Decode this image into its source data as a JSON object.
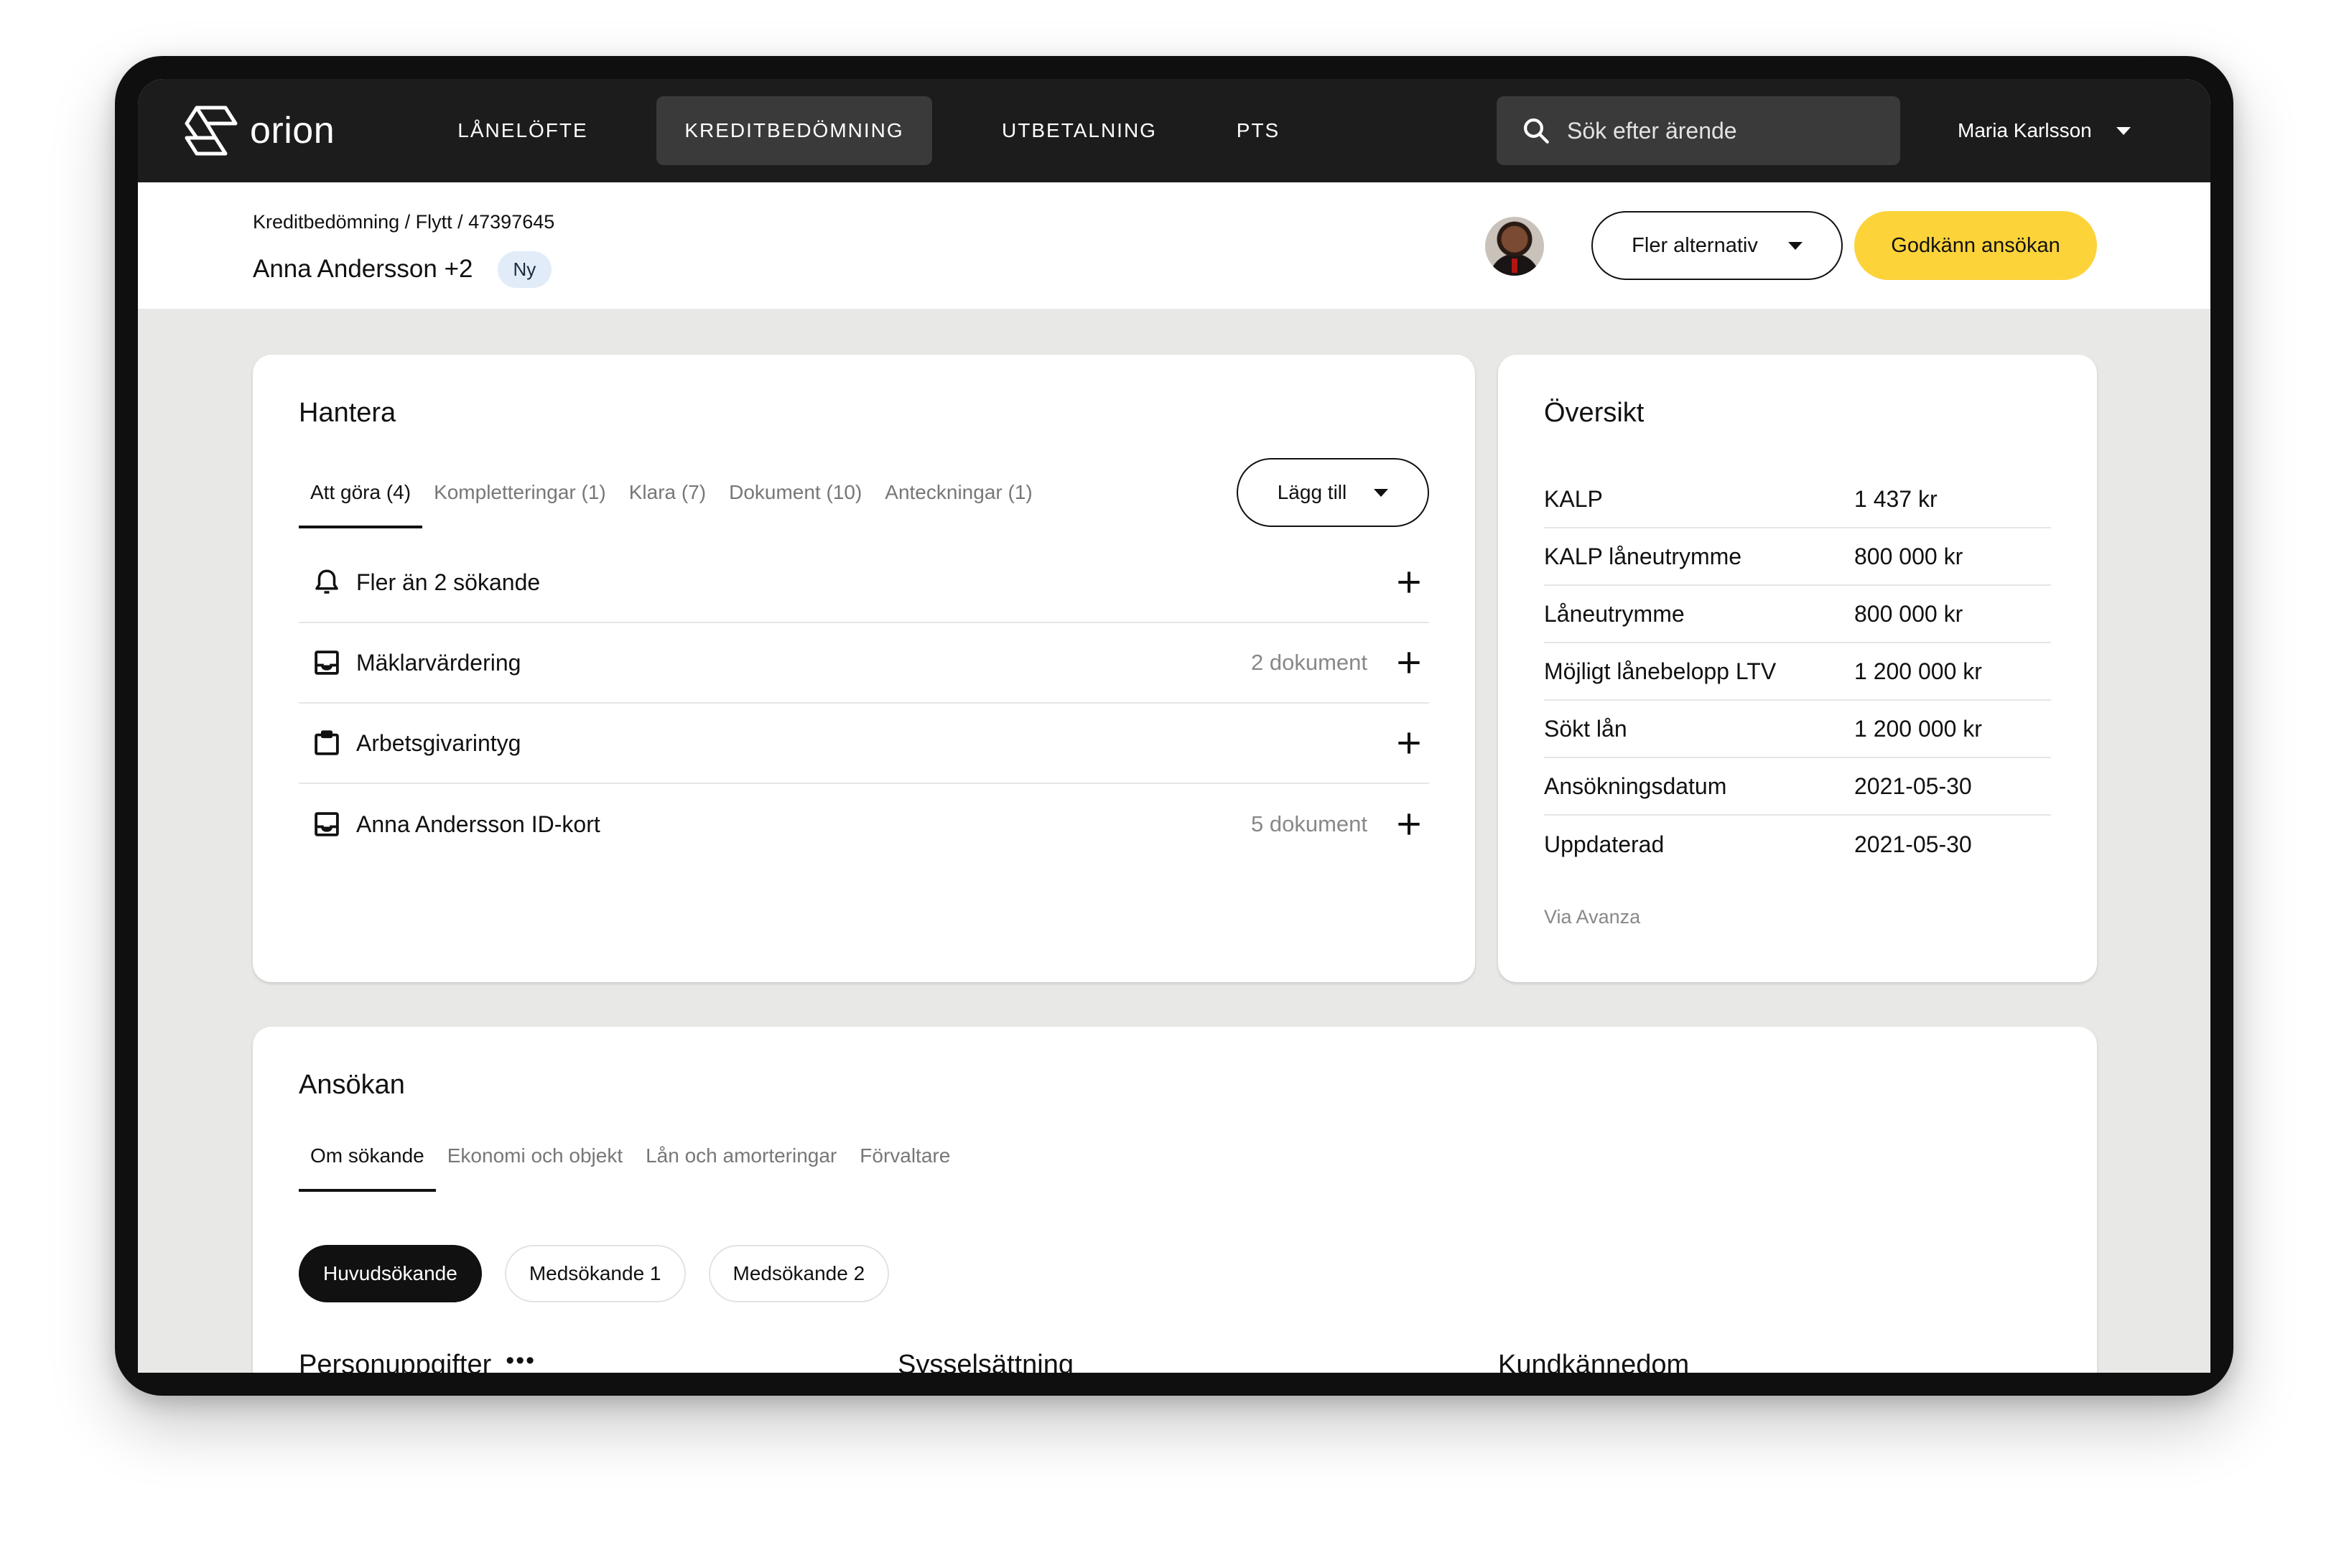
{
  "nav": {
    "logo_text": "orion",
    "items": [
      {
        "label": "LÅNELÖFTE"
      },
      {
        "label": "KREDITBEDÖMNING"
      },
      {
        "label": "UTBETALNING"
      },
      {
        "label": "PTS"
      }
    ],
    "active_index": 1,
    "search_placeholder": "Sök efter ärende",
    "user_name": "Maria Karlsson"
  },
  "header": {
    "breadcrumb": "Kreditbedömning / Flytt / 47397645",
    "title": "Anna Andersson +2",
    "status_badge": "Ny",
    "more_options_label": "Fler alternativ",
    "approve_label": "Godkänn ansökan"
  },
  "manage": {
    "title": "Hantera",
    "tabs": [
      {
        "label": "Att göra (4)"
      },
      {
        "label": "Kompletteringar (1)"
      },
      {
        "label": "Klara (7)"
      },
      {
        "label": "Dokument (10)"
      },
      {
        "label": "Anteckningar (1)"
      }
    ],
    "add_label": "Lägg till",
    "tasks": [
      {
        "label": "Fler än 2 sökande",
        "meta": "",
        "icon": "bell-icon"
      },
      {
        "label": "Mäklarvärdering",
        "meta": "2 dokument",
        "icon": "inbox-icon"
      },
      {
        "label": "Arbetsgivarintyg",
        "meta": "",
        "icon": "clipboard-icon"
      },
      {
        "label": "Anna Andersson ID-kort",
        "meta": "5 dokument",
        "icon": "inbox-icon"
      }
    ]
  },
  "overview": {
    "title": "Översikt",
    "rows": [
      {
        "key": "KALP",
        "value": "1 437 kr"
      },
      {
        "key": "KALP låneutrymme",
        "value": "800 000 kr"
      },
      {
        "key": "Låneutrymme",
        "value": "800 000 kr"
      },
      {
        "key": "Möjligt lånebelopp LTV",
        "value": "1 200 000 kr"
      },
      {
        "key": "Sökt lån",
        "value": "1 200 000 kr"
      },
      {
        "key": "Ansökningsdatum",
        "value": "2021-05-30"
      },
      {
        "key": "Uppdaterad",
        "value": "2021-05-30"
      }
    ],
    "source": "Via Avanza"
  },
  "application": {
    "title": "Ansökan",
    "tabs": [
      {
        "label": "Om sökande"
      },
      {
        "label": "Ekonomi och objekt"
      },
      {
        "label": "Lån och amorteringar"
      },
      {
        "label": "Förvaltare"
      }
    ],
    "applicants": [
      {
        "label": "Huvudsökande"
      },
      {
        "label": "Medsökande 1"
      },
      {
        "label": "Medsökande 2"
      }
    ],
    "sections": [
      {
        "label": "Personuppgifter"
      },
      {
        "label": "Sysselsättning"
      },
      {
        "label": "Kundkännedom"
      }
    ],
    "more_glyph": "•••"
  },
  "colors": {
    "nav_bg": "#1c1c1c",
    "primary_button": "#fdd33a",
    "badge_bg": "#e1ecf8",
    "page_bg": "#e8e9e6"
  }
}
